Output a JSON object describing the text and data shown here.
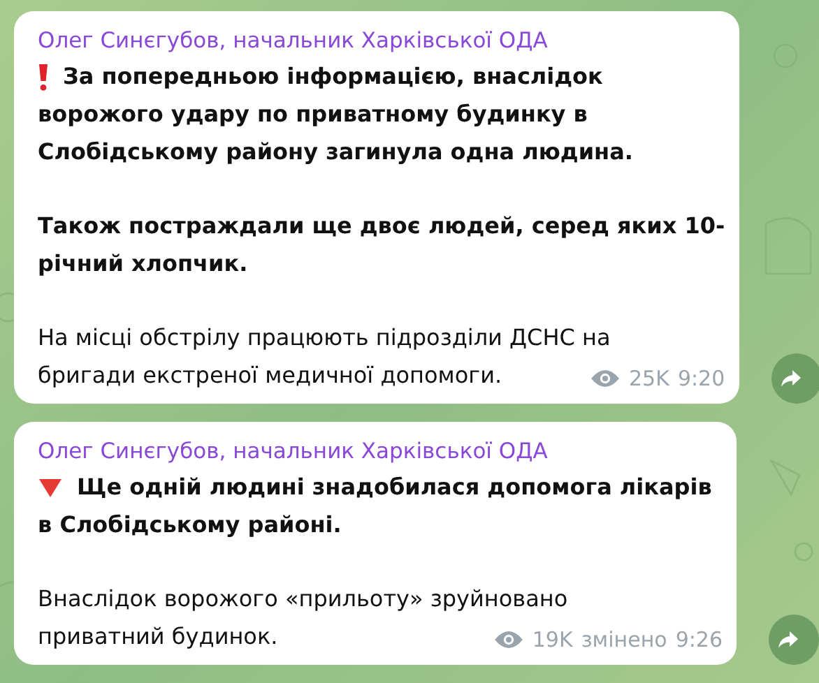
{
  "messages": [
    {
      "author": "Олег Синєгубов, начальник Харківської ОДА",
      "kind": "exclamation",
      "paragraphs": [
        {
          "bold": true,
          "lines": [
            "За попередньою інформацією, внаслідок",
            "ворожого удару по приватному будинку в",
            "Слобідському району загинула одна людина."
          ]
        },
        {
          "bold": true,
          "lines": [
            "Також постраждали ще двоє людей, серед яких 10-",
            "річний хлопчик."
          ]
        },
        {
          "bold": false,
          "lines": [
            "На місці обстрілу працюють підрозділи ДСНС на",
            "бригади екстреної медичної допомоги."
          ]
        }
      ],
      "views": "25K",
      "time": "9:20"
    },
    {
      "author": "Олег Синєгубов, начальник Харківської ОДА",
      "kind": "down-triangle",
      "paragraphs": [
        {
          "bold": true,
          "lines": [
            "Ще одній людині знадобилася допомога лікарів",
            "в Слобідському районі."
          ]
        },
        {
          "bold": false,
          "lines": [
            "Внаслідок ворожого «прильоту» зруйновано",
            "приватний будинок."
          ]
        }
      ],
      "views": "19K",
      "edited_label": "змінено",
      "time": "9:26"
    }
  ]
}
